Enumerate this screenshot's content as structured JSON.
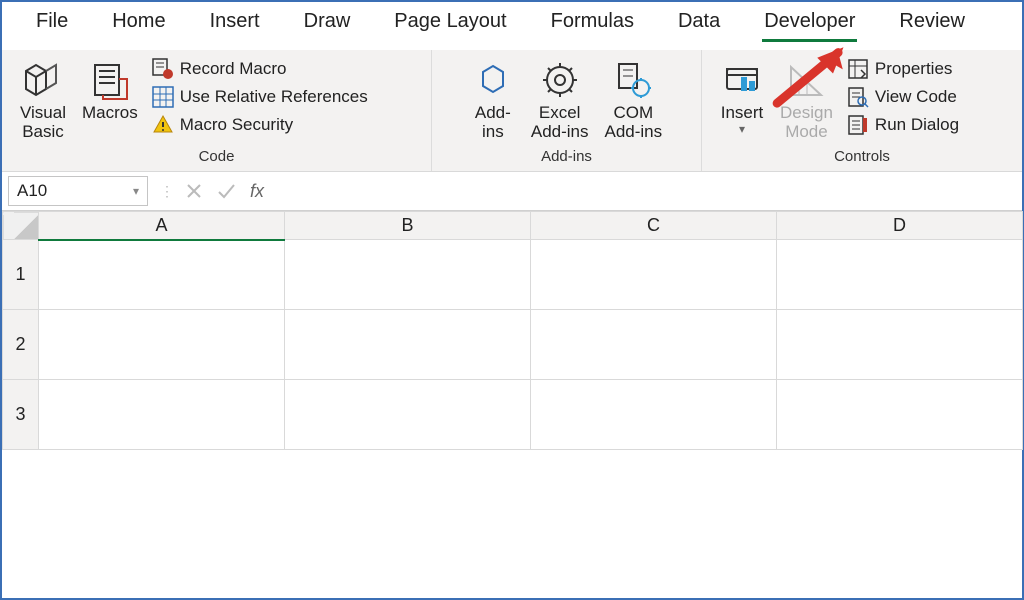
{
  "tabs": [
    "File",
    "Home",
    "Insert",
    "Draw",
    "Page Layout",
    "Formulas",
    "Data",
    "Developer",
    "Review"
  ],
  "active_tab": "Developer",
  "ribbon": {
    "code": {
      "visual_basic": "Visual",
      "visual_basic2": "Basic",
      "macros": "Macros",
      "record_macro": "Record Macro",
      "use_relative": "Use Relative References",
      "macro_security": "Macro Security",
      "label": "Code"
    },
    "addins": {
      "addins": "Add-",
      "addins2": "ins",
      "excel_addins": "Excel",
      "excel_addins2": "Add-ins",
      "com_addins": "COM",
      "com_addins2": "Add-ins",
      "label": "Add-ins"
    },
    "controls": {
      "insert": "Insert",
      "design_mode": "Design",
      "design_mode2": "Mode",
      "properties": "Properties",
      "view_code": "View Code",
      "run_dialog": "Run Dialog",
      "label": "Controls"
    }
  },
  "namebox": "A10",
  "fx_label": "fx",
  "columns": [
    "A",
    "B",
    "C",
    "D"
  ],
  "rows": [
    "1",
    "2",
    "3"
  ],
  "selected_col": "A"
}
